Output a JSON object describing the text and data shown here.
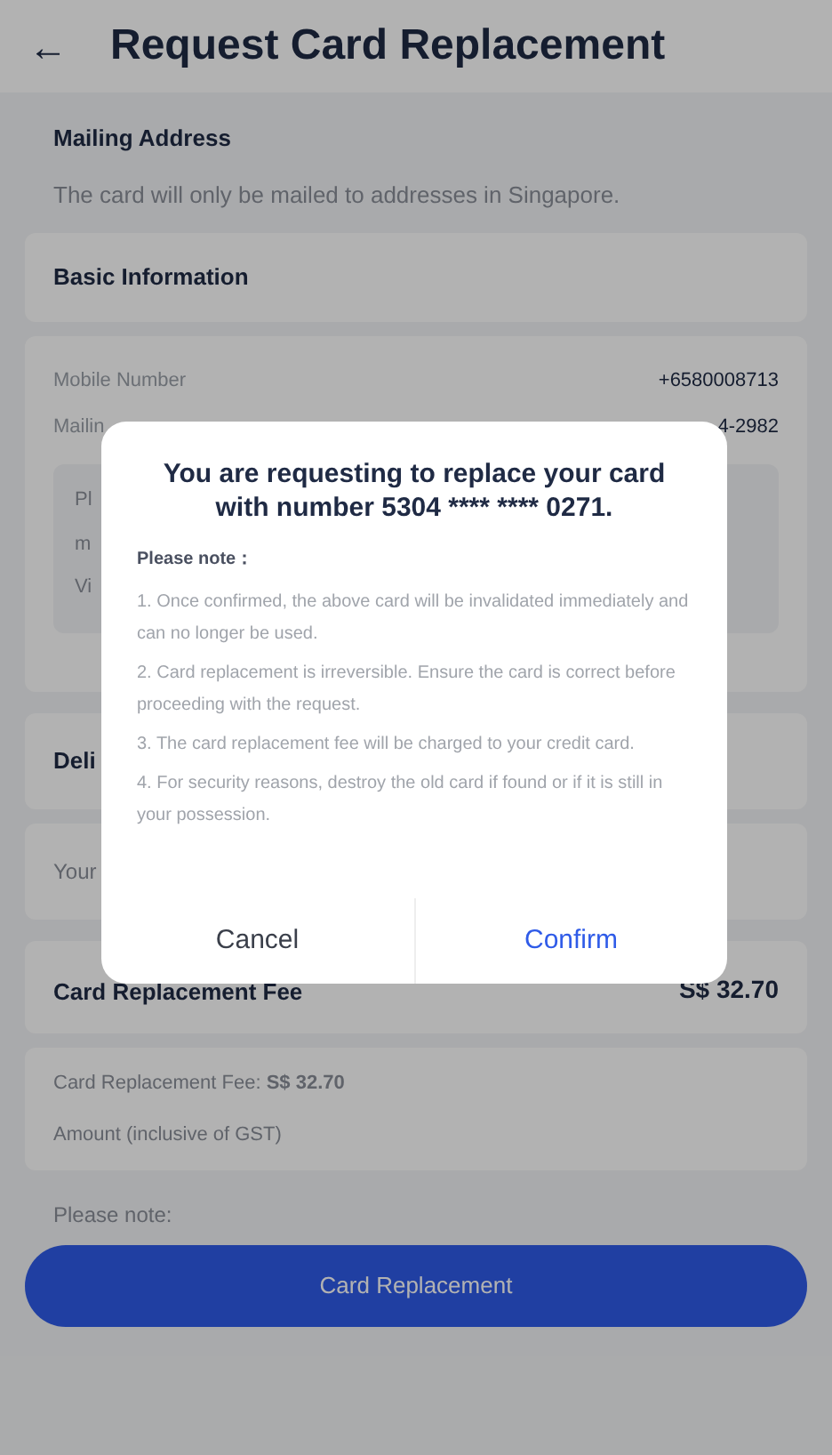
{
  "header": {
    "back": "←",
    "title": "Request Card Replacement"
  },
  "mailing": {
    "title": "Mailing Address",
    "subtitle": "The card will only be mailed to addresses in Singapore."
  },
  "basic_info": {
    "title": "Basic Information"
  },
  "info_rows": [
    {
      "label": "Mobile Number",
      "value": "+6580008713"
    },
    {
      "label": "Mailin",
      "value": "4-2982"
    }
  ],
  "address_box": [
    "Pl",
    "m",
    "Vi"
  ],
  "delivery": {
    "title": "Deli",
    "text": "Your"
  },
  "fee": {
    "title": "Card Replacement Fee",
    "amount": "S$ 32.70",
    "detail": "Card Replacement Fee: **S$ 32.70**",
    "note": "Amount (inclusive of GST)"
  },
  "please_note": "Please note:",
  "primary_button": "Card Replacement",
  "dialog": {
    "title": "You are requesting to replace your card with number 5304 **** **** 0271.",
    "note_label": "Please note：",
    "notes": [
      "1. Once confirmed, the above card will be invalidated immediately and can no longer be used.",
      "2.  Card replacement is irreversible. Ensure the card is correct before proceeding with the request.",
      "3. The card replacement fee will be charged to your credit card.",
      "4. For security reasons, destroy the old card if found or if it is still in your possession."
    ],
    "buttons": [
      {
        "label": "Cancel",
        "kind": "secondary"
      },
      {
        "label": "Confirm",
        "kind": "primary"
      }
    ]
  }
}
